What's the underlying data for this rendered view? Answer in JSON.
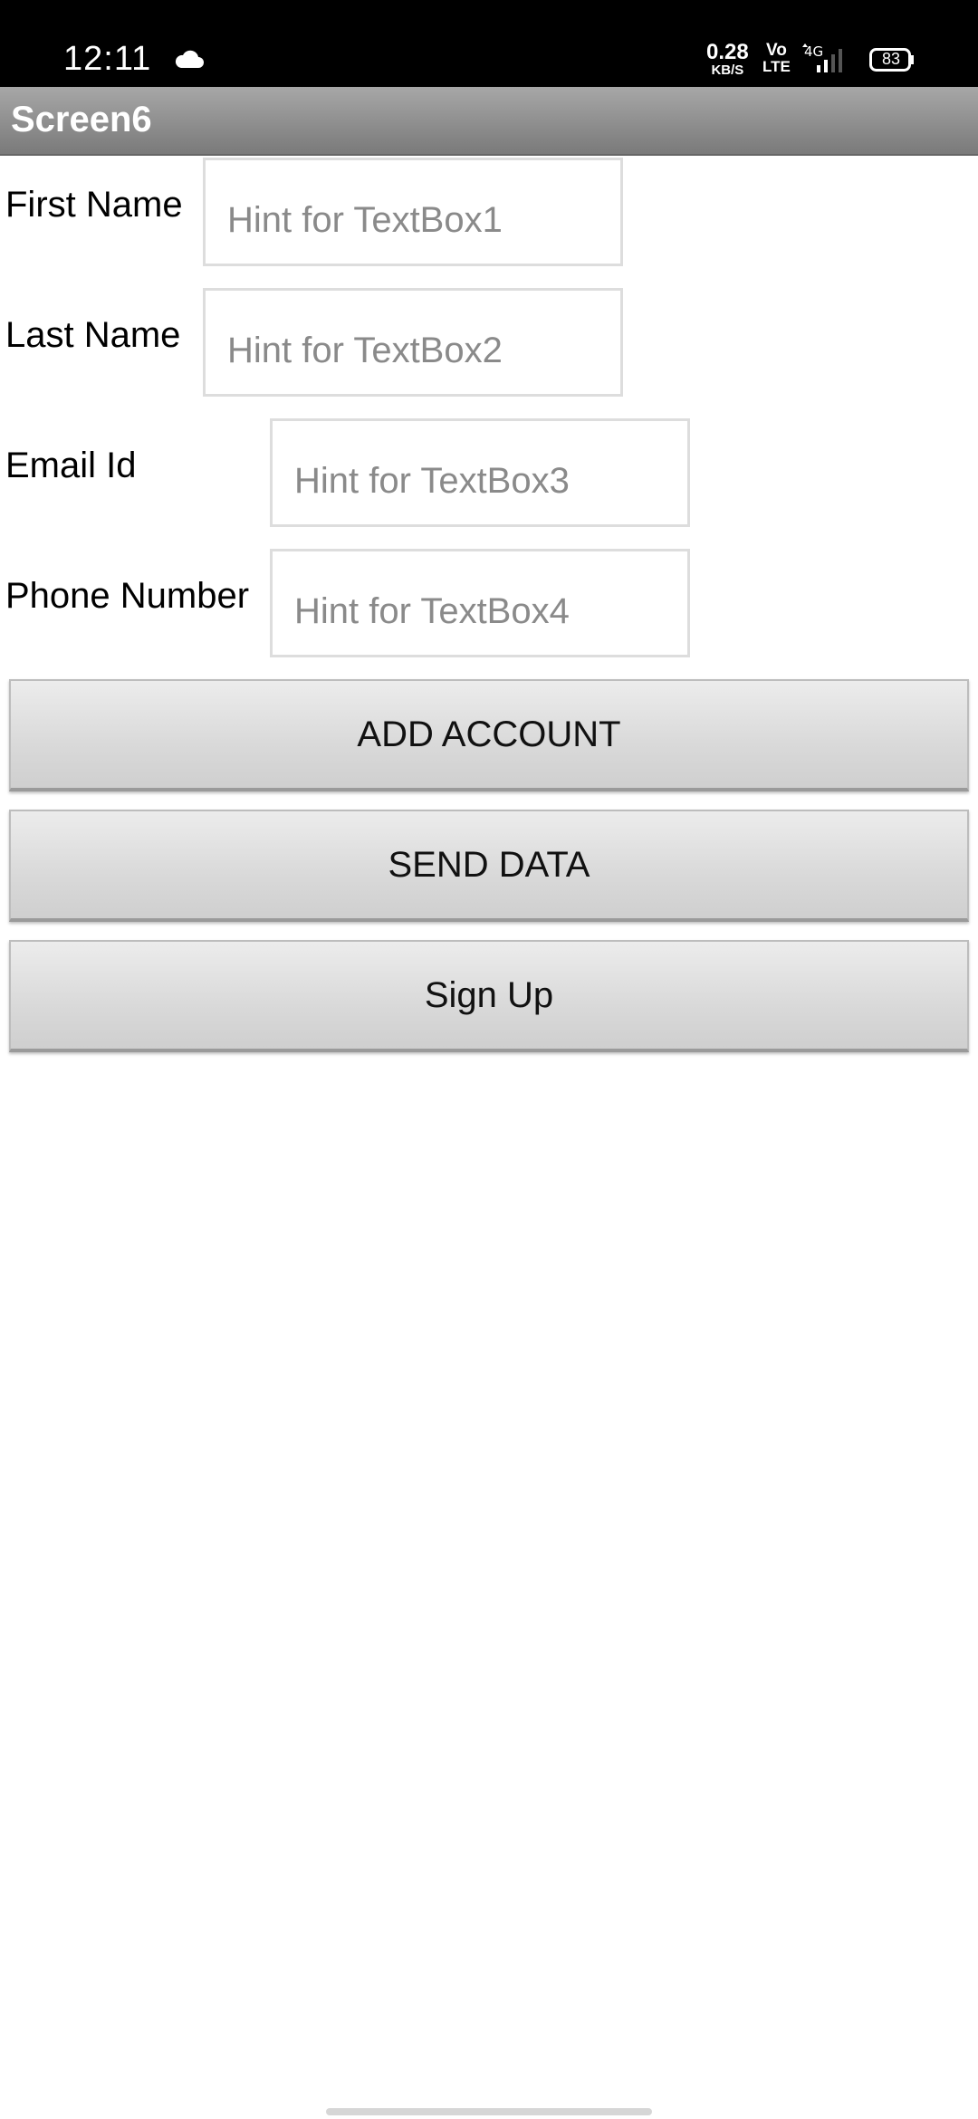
{
  "status_bar": {
    "time": "12:11",
    "net_speed_value": "0.28",
    "net_speed_unit": "KB/S",
    "volte_top": "Vo",
    "volte_bottom": "LTE",
    "network_type": "4G",
    "battery": "83",
    "icons": [
      "cloud-icon",
      "signal-icon",
      "battery-icon"
    ]
  },
  "app": {
    "title": "Screen6",
    "title_bar_color": "#8f8f8f"
  },
  "form": {
    "rows": [
      {
        "label": "First Name",
        "placeholder": "Hint for TextBox1",
        "value": ""
      },
      {
        "label": "Last Name",
        "placeholder": "Hint for TextBox2",
        "value": ""
      },
      {
        "label": "Email Id",
        "placeholder": "Hint for TextBox3",
        "value": ""
      },
      {
        "label": "Phone Number",
        "placeholder": "Hint for TextBox4",
        "value": ""
      }
    ]
  },
  "buttons": {
    "add_account": "ADD ACCOUNT",
    "send_data": "SEND DATA",
    "sign_up": "Sign Up"
  }
}
